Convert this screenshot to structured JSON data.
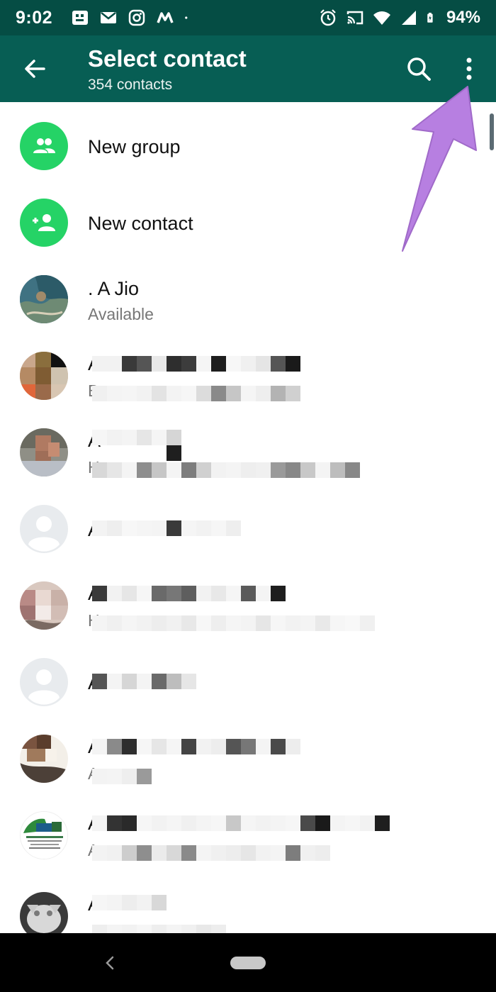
{
  "status_bar": {
    "time": "9:02",
    "battery": "94%",
    "left_icons": [
      "gallery-icon",
      "gmail-icon",
      "instagram-icon",
      "m-icon",
      "dot-icon"
    ],
    "right_icons": [
      "alarm-icon",
      "cast-icon",
      "wifi-icon",
      "signal-icon",
      "battery-icon"
    ]
  },
  "app_bar": {
    "title": "Select contact",
    "subtitle": "354 contacts",
    "background": "#075e54",
    "status_background": "#054d44"
  },
  "actions": {
    "new_group": "New group",
    "new_contact": "New contact",
    "accent": "#25d366"
  },
  "contacts": [
    {
      "name": ". A Jio",
      "status": "Available",
      "avatar": "photo"
    },
    {
      "name": "A",
      "status": "B",
      "avatar": "pixelated"
    },
    {
      "name": "A",
      "status": "H",
      "avatar": "pixelated"
    },
    {
      "name": "A",
      "status": "",
      "avatar": "default"
    },
    {
      "name": "A",
      "status": "H",
      "avatar": "pixelated"
    },
    {
      "name": "A",
      "status": "",
      "avatar": "default"
    },
    {
      "name": "A",
      "status": "A",
      "avatar": "pixelated"
    },
    {
      "name": "A",
      "status": "A",
      "avatar": "logo"
    },
    {
      "name": "A",
      "status": "",
      "avatar": "cat"
    }
  ],
  "annotation": {
    "color": "#b57ee0"
  }
}
